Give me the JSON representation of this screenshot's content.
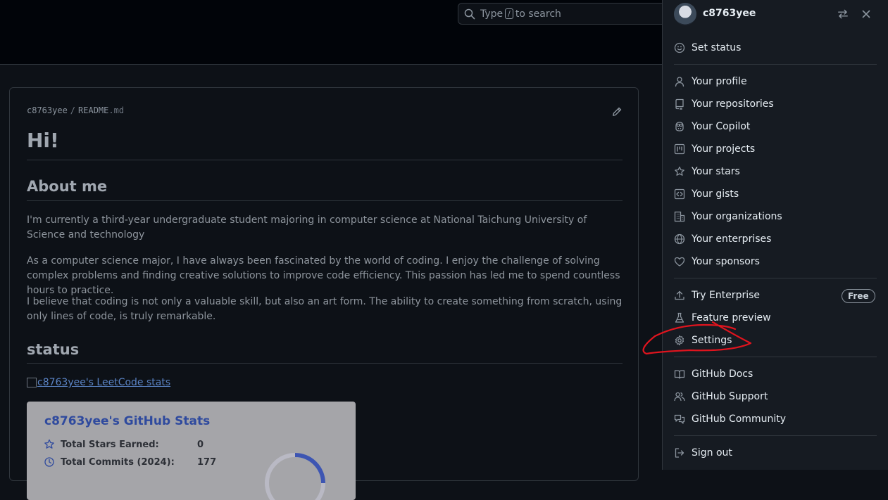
{
  "search": {
    "prefix": "Type",
    "key": "/",
    "suffix": "to search"
  },
  "readme": {
    "owner": "c8763yee",
    "file": "README",
    "ext": ".md",
    "h1": "Hi!",
    "about_heading": "About me",
    "paragraphs": [
      "I'm currently a third-year undergraduate student majoring in computer science at National Taichung University of Science and technology",
      "As a computer science major, I have always been fascinated by the world of coding. I enjoy the challenge of solving complex problems and finding creative solutions to improve code efficiency. This passion has led me to spend countless hours to practice.",
      "I believe that coding is not only a valuable skill, but also an art form. The ability to create something from scratch, using only lines of code, is truly remarkable."
    ],
    "status_heading": "status",
    "leetcode_alt": "c8763yee's LeetCode stats",
    "stats": {
      "title": "c8763yee's GitHub Stats",
      "rows": [
        {
          "label": "Total Stars Earned:",
          "value": "0"
        },
        {
          "label": "Total Commits (2024):",
          "value": "177"
        }
      ]
    }
  },
  "panel": {
    "username": "c8763yee",
    "groups": [
      [
        {
          "icon": "smiley-icon",
          "label": "Set status"
        }
      ],
      [
        {
          "icon": "person-icon",
          "label": "Your profile"
        },
        {
          "icon": "repo-icon",
          "label": "Your repositories"
        },
        {
          "icon": "copilot-icon",
          "label": "Your Copilot"
        },
        {
          "icon": "project-icon",
          "label": "Your projects"
        },
        {
          "icon": "star-icon",
          "label": "Your stars"
        },
        {
          "icon": "code-square-icon",
          "label": "Your gists"
        },
        {
          "icon": "organization-icon",
          "label": "Your organizations"
        },
        {
          "icon": "globe-icon",
          "label": "Your enterprises"
        },
        {
          "icon": "heart-icon",
          "label": "Your sponsors"
        }
      ],
      [
        {
          "icon": "upload-icon",
          "label": "Try Enterprise",
          "badge": "Free"
        },
        {
          "icon": "beaker-icon",
          "label": "Feature preview"
        },
        {
          "icon": "gear-icon",
          "label": "Settings"
        }
      ],
      [
        {
          "icon": "book-icon",
          "label": "GitHub Docs"
        },
        {
          "icon": "people-icon",
          "label": "GitHub Support"
        },
        {
          "icon": "comment-discussion-icon",
          "label": "GitHub Community"
        }
      ],
      [
        {
          "icon": "sign-out-icon",
          "label": "Sign out"
        }
      ]
    ]
  },
  "colors": {
    "annotation": "#e0141e",
    "link": "#2f4a9e"
  }
}
